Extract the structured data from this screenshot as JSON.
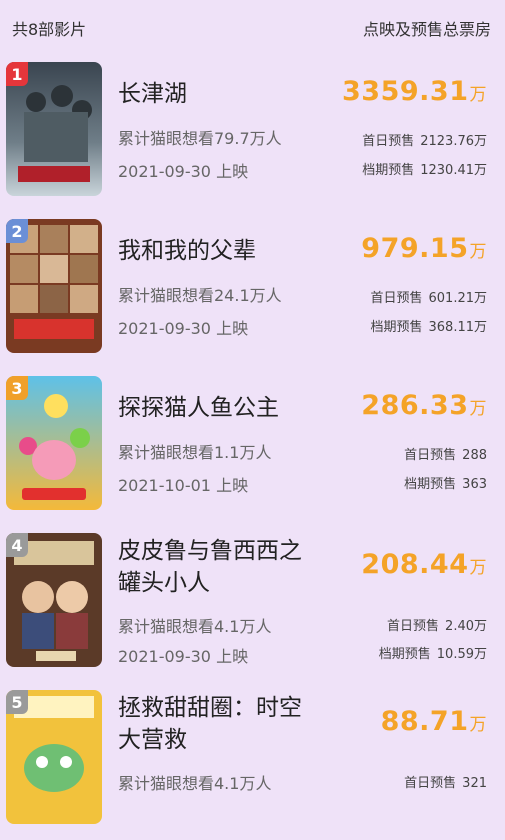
{
  "header": {
    "count_label": "共8部影片",
    "box_office_label": "点映及预售总票房"
  },
  "labels": {
    "unit": "万",
    "first_day": "首日预售",
    "period": "档期预售"
  },
  "colors": {
    "background": "#efe2f8",
    "amount": "#f4a328",
    "rank_1": "#e5363b",
    "rank_2": "#6b8fd6",
    "rank_3": "#f0a02a",
    "rank_4": "#9a9a9a",
    "rank_5": "#9a9a9a"
  },
  "movies": [
    {
      "rank": "1",
      "title": "长津湖",
      "want": "累计猫眼想看79.7万人",
      "release": "2021-09-30 上映",
      "amount": "3359.31",
      "first_day": "2123.76万",
      "period": "1230.41万"
    },
    {
      "rank": "2",
      "title": "我和我的父辈",
      "want": "累计猫眼想看24.1万人",
      "release": "2021-09-30 上映",
      "amount": "979.15",
      "first_day": "601.21万",
      "period": "368.11万"
    },
    {
      "rank": "3",
      "title": "探探猫人鱼公主",
      "want": "累计猫眼想看1.1万人",
      "release": "2021-10-01 上映",
      "amount": "286.33",
      "first_day": "288",
      "period": "363"
    },
    {
      "rank": "4",
      "title_line1": "皮皮鲁与鲁西西之",
      "title_line2": "罐头小人",
      "want": "累计猫眼想看4.1万人",
      "release": "2021-09-30 上映",
      "amount": "208.44",
      "first_day": "2.40万",
      "period": "10.59万"
    },
    {
      "rank": "5",
      "title_line1": "拯救甜甜圈：时空",
      "title_line2": "大营救",
      "want": "累计猫眼想看4.1万人",
      "amount": "88.71",
      "first_day": "321"
    }
  ]
}
